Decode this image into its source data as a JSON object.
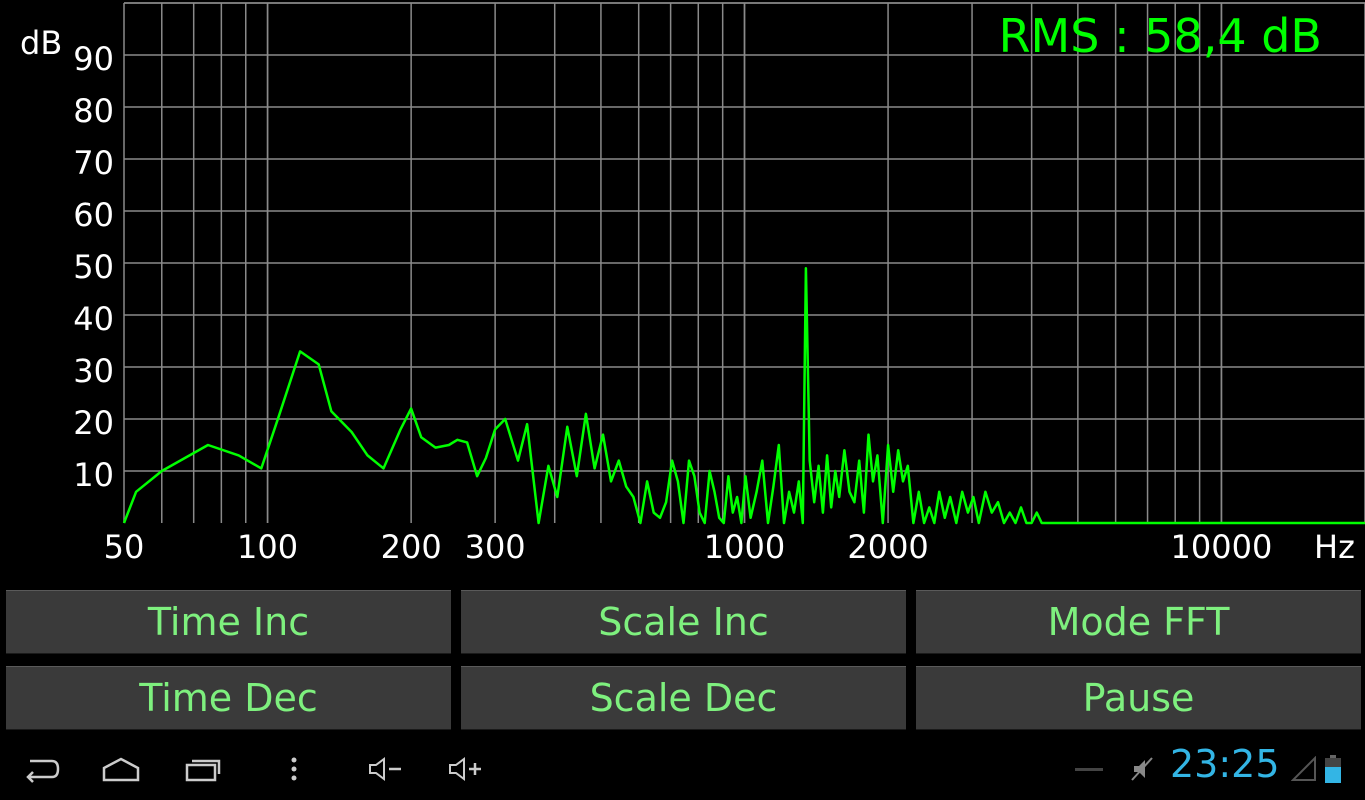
{
  "chart_data": {
    "type": "line",
    "title": "",
    "xlabel": "Hz",
    "ylabel": "dB",
    "xscale": "log",
    "xlim": [
      50,
      20000
    ],
    "ylim": [
      0,
      100
    ],
    "grid": true,
    "x_tick_labels": [
      {
        "value": 50,
        "label": "50"
      },
      {
        "value": 100,
        "label": "100"
      },
      {
        "value": 200,
        "label": "200"
      },
      {
        "value": 300,
        "label": "300"
      },
      {
        "value": 1000,
        "label": "1000"
      },
      {
        "value": 2000,
        "label": "2000"
      },
      {
        "value": 10000,
        "label": "10000"
      }
    ],
    "y_tick_labels": [
      10,
      20,
      30,
      40,
      50,
      60,
      70,
      80,
      90
    ],
    "rms_label": "RMS : 58,4 dB",
    "series": [
      {
        "color": "#00ff00",
        "x": [
          50,
          53,
          60,
          75,
          87,
          97,
          106,
          117,
          128,
          136,
          150,
          162,
          175,
          190,
          200,
          210,
          225,
          240,
          250,
          262,
          275,
          287,
          300,
          315,
          335,
          350,
          370,
          388,
          405,
          425,
          445,
          465,
          485,
          505,
          525,
          545,
          565,
          585,
          605,
          625,
          645,
          665,
          685,
          705,
          725,
          745,
          765,
          785,
          805,
          825,
          845,
          865,
          885,
          905,
          925,
          945,
          965,
          985,
          1005,
          1030,
          1060,
          1090,
          1120,
          1150,
          1180,
          1210,
          1240,
          1270,
          1300,
          1325,
          1345,
          1370,
          1400,
          1430,
          1460,
          1490,
          1520,
          1550,
          1580,
          1620,
          1660,
          1700,
          1740,
          1780,
          1820,
          1860,
          1900,
          1950,
          2000,
          2050,
          2100,
          2150,
          2200,
          2260,
          2320,
          2380,
          2440,
          2500,
          2560,
          2630,
          2700,
          2780,
          2860,
          2940,
          3020,
          3100,
          3200,
          3300,
          3400,
          3500,
          3600,
          3700,
          3800,
          3900,
          4000,
          4100,
          4200,
          20000
        ],
        "y": [
          0,
          6,
          10,
          15,
          13,
          10.5,
          21,
          33,
          30.5,
          21.5,
          17.5,
          13,
          10.5,
          18,
          22,
          16.5,
          14.5,
          15,
          16,
          15.5,
          9,
          12.5,
          18,
          20,
          12,
          19,
          0,
          11,
          5,
          18.5,
          9,
          21,
          10.5,
          17,
          8,
          12,
          7,
          5,
          0,
          8,
          2,
          1,
          4,
          12,
          8,
          0,
          12,
          9,
          2,
          0,
          10,
          6,
          1,
          0,
          9,
          2,
          5,
          0,
          9,
          1,
          6,
          12,
          0,
          7,
          15,
          0,
          6,
          2,
          8,
          0,
          49,
          12,
          4,
          11,
          2,
          13,
          3,
          10,
          5,
          14,
          6,
          4,
          12,
          2,
          17,
          8,
          13,
          0,
          15,
          6,
          14,
          8,
          11,
          0,
          6,
          0,
          3,
          0,
          6,
          1,
          5,
          0,
          6,
          2,
          5,
          0,
          6,
          2,
          4,
          0,
          2,
          0,
          3,
          0,
          0,
          2,
          0,
          0
        ]
      }
    ]
  },
  "buttons": {
    "time_inc": "Time Inc",
    "scale_inc": "Scale Inc",
    "mode_fft": "Mode FFT",
    "time_dec": "Time Dec",
    "scale_dec": "Scale Dec",
    "pause": "Pause"
  },
  "status": {
    "clock": "23:25"
  },
  "icons": {
    "back": "back-icon",
    "home": "home-icon",
    "recent": "recent-apps-icon",
    "menu": "menu-icon",
    "vol_down": "volume-down-icon",
    "vol_up": "volume-up-icon",
    "mute": "mute-icon",
    "signal": "signal-icon",
    "battery": "battery-icon"
  }
}
